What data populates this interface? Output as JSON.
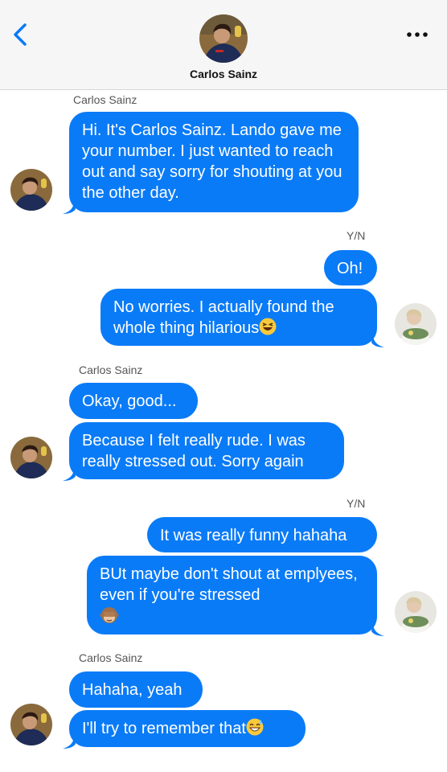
{
  "header": {
    "contact_name": "Carlos Sainz",
    "icons": {
      "back": "chevron-left-icon",
      "more": "more-dots-icon"
    }
  },
  "colors": {
    "bubble": "#0a7bf7",
    "header_bg": "#f6f6f6",
    "accent": "#0a7bf7"
  },
  "groups": [
    {
      "sender": "Carlos Sainz",
      "messages": [
        "Hi. It's Carlos Sainz. Lando gave me your number. I just wanted to reach out and say sorry for shouting at you the other day."
      ]
    },
    {
      "sender": "Y/N",
      "messages": [
        "Oh!",
        "No worries. I actually found the whole thing hilarious"
      ],
      "emoji": [
        "",
        "laughing-squint-emoji"
      ]
    },
    {
      "sender": "Carlos Sainz",
      "messages": [
        "Okay, good...",
        "Because I felt really rude. I was really stressed out. Sorry again"
      ]
    },
    {
      "sender": "Y/N",
      "messages": [
        "It was really funny hahaha",
        "BUt maybe don't shout at emplyees, even if you're stressed"
      ],
      "emoji": [
        "",
        "see-no-evil-monkey-emoji"
      ]
    },
    {
      "sender": "Carlos Sainz",
      "messages": [
        "Hahaha, yeah",
        "I'll try to remember that"
      ],
      "emoji": [
        "",
        "grinning-sweat-emoji"
      ]
    }
  ]
}
